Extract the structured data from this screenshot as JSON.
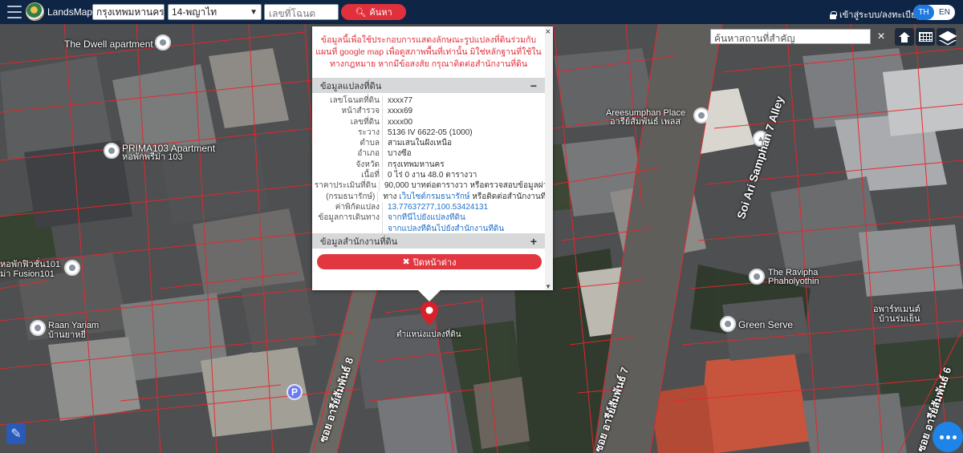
{
  "app": {
    "brand": "LandsMaps",
    "province_select": "กรุงเทพมหานคร",
    "district_select": "14-พญาไท",
    "deed_placeholder": "เลขที่โฉนด",
    "search_button": "ค้นหา",
    "login_link": "เข้าสู่ระบบ/ลงทะเบียน",
    "lang_th": "TH",
    "lang_en": "EN"
  },
  "map_tools": {
    "place_search_placeholder": "ค้นหาสถานที่สำคัญ",
    "clear": "×"
  },
  "popup": {
    "close": "×",
    "disclaimer": "ข้อมูลนี้เพื่อใช้ประกอบการแสดงลักษณะรูปแปลงที่ดินร่วมกับแผนที่ google map เพื่อดูสภาพพื้นที่เท่านั้น มิใช่หลักฐานที่ใช้ในทางกฎหมาย หากมีข้อสงสัย กรุณาติดต่อสำนักงานที่ดิน",
    "section1_title": "ข้อมูลแปลงที่ดิน",
    "section1_toggle": "−",
    "section2_title": "ข้อมูลสำนักงานที่ดิน",
    "section2_toggle": "+",
    "rows": [
      {
        "key": "เลขโฉนดที่ดิน",
        "value": "xxxx77"
      },
      {
        "key": "หน้าสำรวจ",
        "value": "xxxx69"
      },
      {
        "key": "เลขที่ดิน",
        "value": "xxxx00"
      },
      {
        "key": "ระวาง",
        "value": "5136 IV 6622-05 (1000)"
      },
      {
        "key": "ตำบล",
        "value": "สามเสนในฝั่งเหนือ"
      },
      {
        "key": "อำเภอ",
        "value": "บางซื่อ"
      },
      {
        "key": "จังหวัด",
        "value": "กรุงเทพมหานคร"
      },
      {
        "key": "เนื้อที่",
        "value": "0 ไร่ 0 งาน 48.0 ตารางวา"
      },
      {
        "key": "ราคาประเมินที่ดิน",
        "value": "90,000 บาทต่อตารางวา หรือตรวจสอบข้อมูลผ่าน"
      },
      {
        "key": "(กรมธนารักษ์)",
        "value": "ทาง เว็บไซต์กรมธนารักษ์ หรือติดต่อสำนักงานที่ดิน"
      },
      {
        "key": "ค่าพิกัดแปลง",
        "value": "13.77637277,100.53424131"
      },
      {
        "key": "ข้อมูลการเดินทาง",
        "value": "จากที่นี่ไปยังแปลงที่ดิน"
      },
      {
        "key": "",
        "value": "จากแปลงที่ดินไปยังสำนักงานที่ดิน"
      }
    ],
    "close_window_button": "ปิดหน้าต่าง"
  },
  "marker_label": "ตำแหน่งแปลงที่ดิน",
  "map_labels": {
    "dwell": "The Dwell apartment",
    "prima": "PRIMA103 Apartment",
    "prima_th": "หอพักพรีม่า 103",
    "fusion_th": "หอพักฟิวชั่น101",
    "fusion": "ม่า Fusion101",
    "raan": "Raan Yariam",
    "raan_th": "บ้านยาหยี่",
    "areesumphan": "Areesumphan Place",
    "areesumphan_th": "อารีย์สัมพันธ์ เพลส",
    "ravipha": "The Ravipha",
    "ravipha2": "Phaholyothin",
    "green": "Green Serve",
    "apartment_th": "อพาร์ทเมนต์",
    "apartment_th2": "บ้านร่มเย็น",
    "road1": "Soi Ari Samphan 7 Alley",
    "road2": "ซอย อารีย์สัมพันธ์ 8",
    "road3": "ซอย อารีย์สัมพันธ์ 7",
    "road4": "ซอย อารีย์สัมพันธ์ 6",
    "parking": "P"
  },
  "colors": {
    "topbar": "#0f2545",
    "accent_red": "#e0303b",
    "parcel_line": "#e8262c",
    "lang_active": "#1f7ae0"
  }
}
